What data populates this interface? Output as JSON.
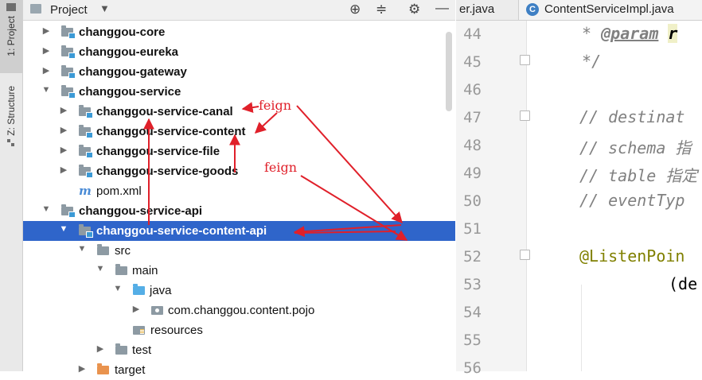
{
  "sidebar": {
    "project_tab": "1: Project",
    "structure_tab": "Z: Structure"
  },
  "panel": {
    "title": "Project",
    "dropdown": "▼",
    "icons": [
      "locate-icon",
      "collapse-icon",
      "gear-icon",
      "hide-icon"
    ],
    "tree": [
      {
        "label": "changgou-core",
        "arrow": "▶",
        "icon": "module-folder-icon",
        "bold": true
      },
      {
        "label": "changgou-eureka",
        "arrow": "▶",
        "icon": "module-folder-icon",
        "bold": true
      },
      {
        "label": "changgou-gateway",
        "arrow": "▶",
        "icon": "module-folder-icon",
        "bold": true
      },
      {
        "label": "changgou-service",
        "arrow": "▼",
        "icon": "module-folder-icon",
        "bold": true
      },
      {
        "label": "changgou-service-canal",
        "arrow": "▶",
        "icon": "module-folder-icon",
        "bold": true
      },
      {
        "label": "changgou-service-content",
        "arrow": "▶",
        "icon": "module-folder-icon",
        "bold": true
      },
      {
        "label": "changgou-service-file",
        "arrow": "▶",
        "icon": "module-folder-icon",
        "bold": true
      },
      {
        "label": "changgou-service-goods",
        "arrow": "▶",
        "icon": "module-folder-icon",
        "bold": true
      },
      {
        "label": "pom.xml",
        "arrow": "",
        "icon": "maven-icon",
        "bold": false
      },
      {
        "label": "changgou-service-api",
        "arrow": "▼",
        "icon": "module-folder-icon",
        "bold": true
      },
      {
        "label": "changgou-service-content-api",
        "arrow": "▼",
        "icon": "module-folder-icon",
        "bold": true,
        "selected": true
      },
      {
        "label": "src",
        "arrow": "▼",
        "icon": "folder-icon",
        "bold": false
      },
      {
        "label": "main",
        "arrow": "▼",
        "icon": "folder-icon",
        "bold": false
      },
      {
        "label": "java",
        "arrow": "▼",
        "icon": "source-folder-icon",
        "bold": false
      },
      {
        "label": "com.changgou.content.pojo",
        "arrow": "▶",
        "icon": "package-icon",
        "bold": false
      },
      {
        "label": "resources",
        "arrow": "",
        "icon": "resources-folder-icon",
        "bold": false
      },
      {
        "label": "test",
        "arrow": "▶",
        "icon": "folder-icon",
        "bold": false
      },
      {
        "label": "target",
        "arrow": "▶",
        "icon": "target-folder-icon",
        "bold": false
      }
    ]
  },
  "editor": {
    "tabs": [
      {
        "label": "er.java"
      },
      {
        "label": "ContentServiceImpl.java",
        "icon_letter": "C"
      }
    ],
    "line_numbers": [
      "44",
      "45",
      "46",
      "47",
      "48",
      "49",
      "50",
      "51",
      "52",
      "53",
      "54",
      "55",
      "56"
    ],
    "code": {
      "l44_star": " * ",
      "l44_tag": "@param",
      "l44_param": "r",
      "l45": " */",
      "l47": "// destinat",
      "l48": "// schema 指",
      "l49": "// table 指定",
      "l50": "// eventTyp",
      "l52": "@ListenPoin",
      "l53": "(de"
    }
  },
  "annotations": {
    "label_1": "feign",
    "label_2": "feign",
    "arrow_color": "#e0202a"
  },
  "colors": {
    "selection": "#2f65ca",
    "module_badge": "#3c9ad6",
    "annotation": "#808000"
  }
}
